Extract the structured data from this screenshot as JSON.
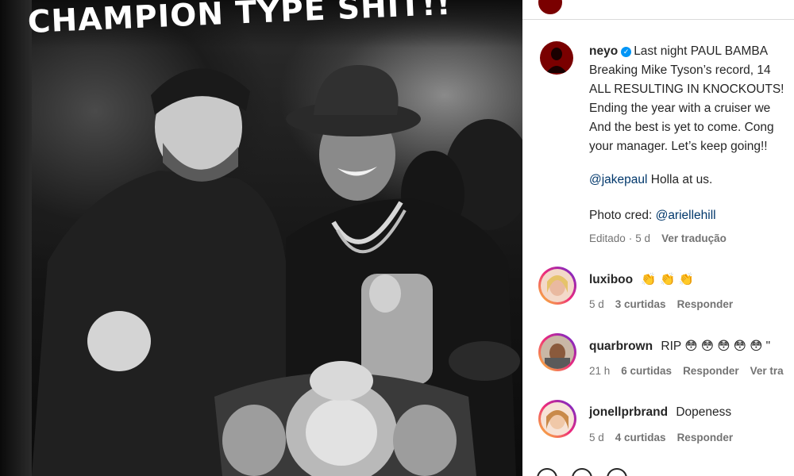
{
  "photo": {
    "caption": "CHAMPION TYPE SHIT!!"
  },
  "post": {
    "author": "neyo",
    "lines": [
      "Last night PAUL BAMBA",
      "Breaking Mike Tyson’s record, 14",
      "ALL RESULTING IN KNOCKOUTS!",
      "Ending the year with a cruiser we",
      "And the best is yet to come. Cong",
      "your manager. Let’s keep going!!"
    ],
    "mention_line": {
      "mention": "@jakepaul",
      "text": " Holla at us."
    },
    "credit_line": {
      "text": "Photo cred: ",
      "mention": "@ariellehill"
    },
    "meta": {
      "edited": "Editado",
      "dot": "·",
      "age": "5 d",
      "translate": "Ver tradução"
    }
  },
  "comments": [
    {
      "user": "luxiboo",
      "text": "👏 👏 👏",
      "age": "5 d",
      "likes": "3 curtidas",
      "reply": "Responder",
      "extra": ""
    },
    {
      "user": "quarbrown",
      "text": "RIP 😳 😳 😳 😳 😳 \"",
      "age": "21 h",
      "likes": "6 curtidas",
      "reply": "Responder",
      "extra": "Ver tra"
    },
    {
      "user": "jonellprbrand",
      "text": "Dopeness",
      "age": "5 d",
      "likes": "4 curtidas",
      "reply": "Responder",
      "extra": ""
    }
  ],
  "icons": {
    "post_avatar": "neyo-avatar",
    "verified": "verified-badge-icon",
    "bottom": [
      "heart-icon",
      "comment-icon",
      "share-icon"
    ]
  },
  "colors": {
    "verified": "#0095f6",
    "mention": "#00376b",
    "meta": "#737373",
    "story_ring": "#ee2a7b"
  }
}
